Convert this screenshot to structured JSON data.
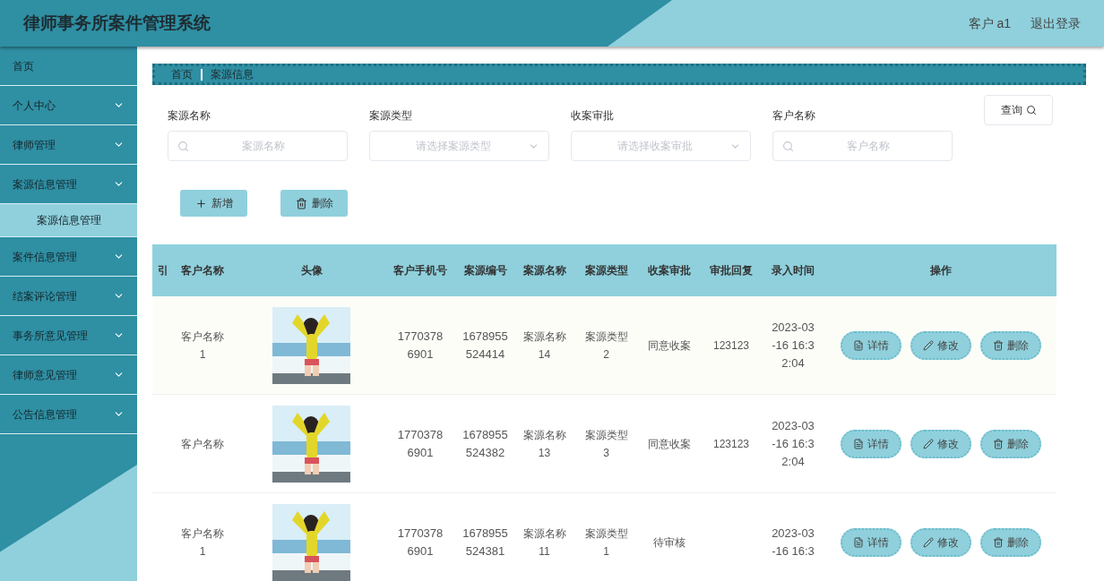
{
  "header": {
    "title": "律师事务所案件管理系统",
    "user": "客户 a1",
    "logout": "退出登录"
  },
  "sidebar": {
    "items": [
      {
        "label": "首页",
        "kind": "link",
        "selected": false
      },
      {
        "label": "个人中心",
        "kind": "group",
        "selected": false
      },
      {
        "label": "律师管理",
        "kind": "group",
        "selected": false
      },
      {
        "label": "案源信息管理",
        "kind": "group",
        "selected": false,
        "children": [
          {
            "label": "案源信息管理",
            "selected": true
          }
        ]
      },
      {
        "label": "案件信息管理",
        "kind": "group",
        "selected": false
      },
      {
        "label": "结案评论管理",
        "kind": "group",
        "selected": false
      },
      {
        "label": "事务所意见管理",
        "kind": "group",
        "selected": false
      },
      {
        "label": "律师意见管理",
        "kind": "group",
        "selected": false
      },
      {
        "label": "公告信息管理",
        "kind": "group",
        "selected": false
      }
    ]
  },
  "breadcrumb": [
    "首页",
    "案源信息"
  ],
  "filters": [
    {
      "kind": "search",
      "label": "案源名称",
      "placeholder": "案源名称"
    },
    {
      "kind": "select",
      "label": "案源类型",
      "placeholder": "请选择案源类型"
    },
    {
      "kind": "select",
      "label": "收案审批",
      "placeholder": "请选择收案审批"
    },
    {
      "kind": "search",
      "label": "客户名称",
      "placeholder": "客户名称"
    }
  ],
  "query_button": "查询",
  "toolbar": [
    {
      "kind": "add",
      "label": "新增"
    },
    {
      "kind": "delete",
      "label": "删除"
    }
  ],
  "table": {
    "columns": [
      "引",
      "客户名称",
      "头像",
      "客户手机号",
      "案源编号",
      "案源名称",
      "案源类型",
      "收案审批",
      "审批回复",
      "录入时间",
      "操作"
    ],
    "rows": [
      {
        "cells": [
          "",
          "客户名称1",
          {
            "kind": "picture"
          },
          "17703786901",
          "1678955524414",
          "案源名称14",
          "案源类型2",
          "同意收案",
          "123123",
          "2023-03-16 16:32:04"
        ],
        "actions": [
          {
            "kind": "detail",
            "label": "详情"
          },
          {
            "kind": "edit",
            "label": "修改"
          },
          {
            "kind": "delete",
            "label": "删除"
          }
        ]
      },
      {
        "cells": [
          "",
          "客户名称",
          {
            "kind": "picture"
          },
          "17703786901",
          "1678955524382",
          "案源名称13",
          "案源类型3",
          "同意收案",
          "123123",
          "2023-03-16 16:32:04"
        ],
        "actions": [
          {
            "kind": "detail",
            "label": "详情"
          },
          {
            "kind": "edit",
            "label": "修改"
          },
          {
            "kind": "delete",
            "label": "删除"
          }
        ]
      },
      {
        "cells": [
          "",
          "客户名称1",
          {
            "kind": "picture"
          },
          "17703786901",
          "1678955524381",
          "案源名称11",
          "案源类型1",
          "待审核",
          "",
          "2023-03-16 16:3"
        ],
        "actions": [
          {
            "kind": "detail",
            "label": "详情"
          },
          {
            "kind": "edit",
            "label": "修改"
          },
          {
            "kind": "delete",
            "label": "删除"
          }
        ]
      }
    ]
  }
}
